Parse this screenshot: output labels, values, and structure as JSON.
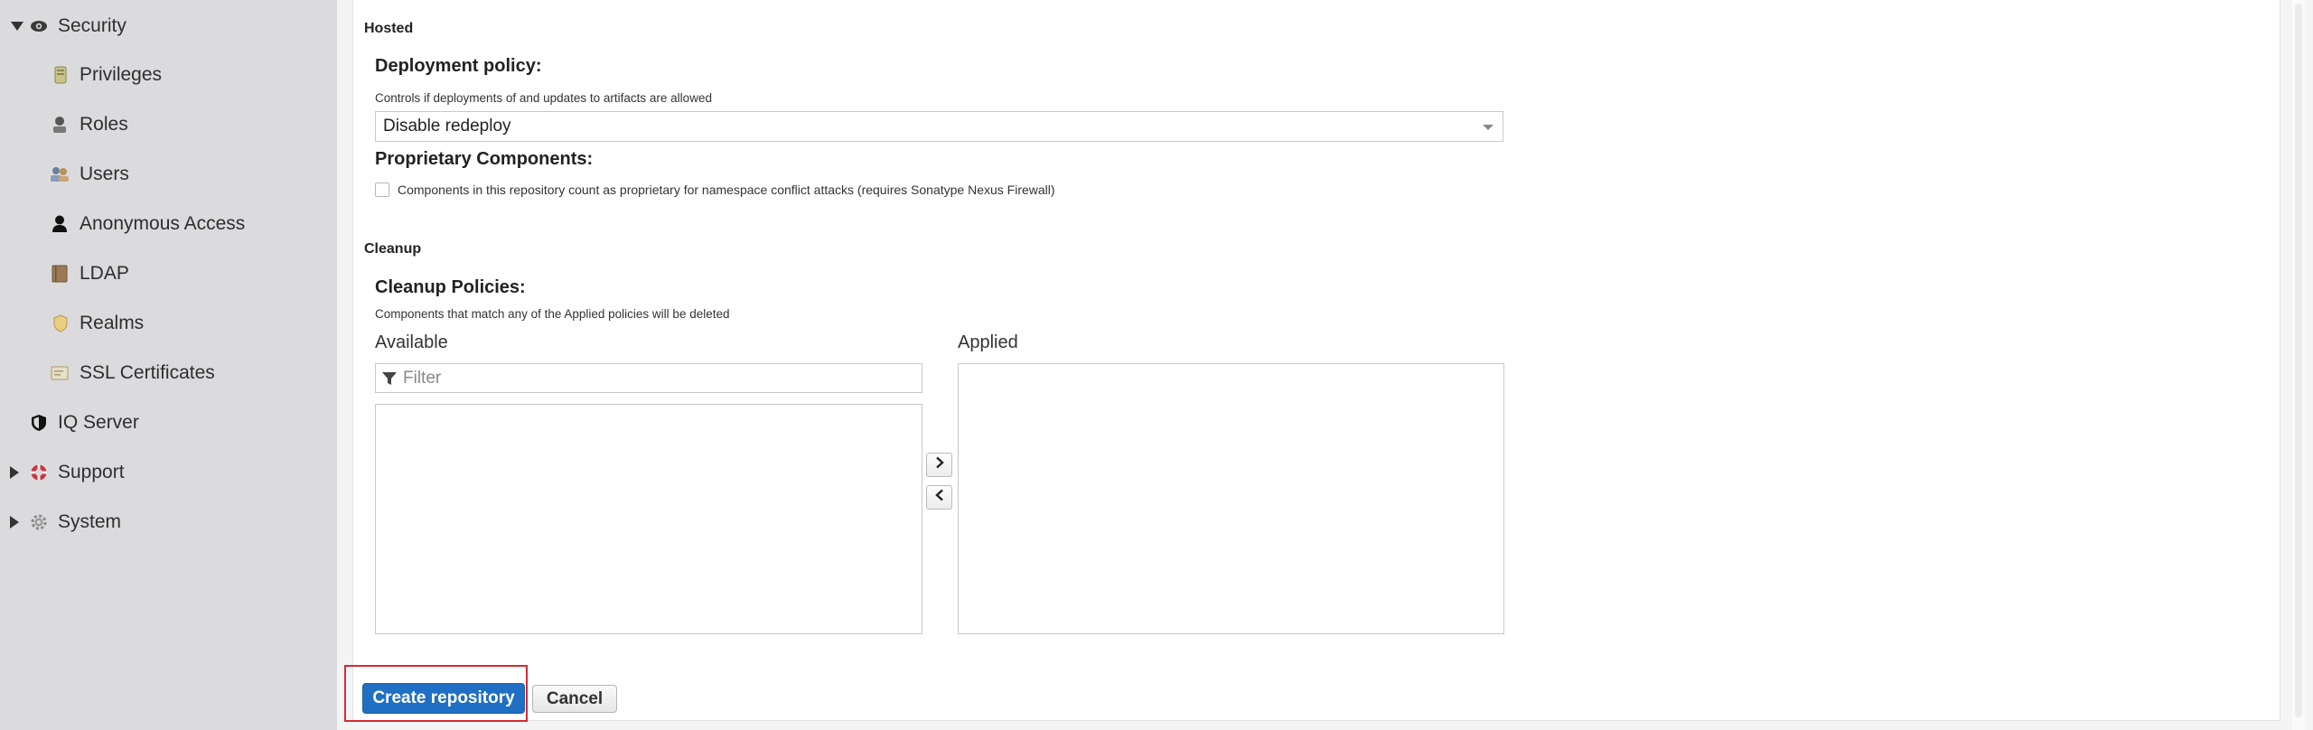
{
  "sidebar": {
    "items": [
      {
        "label": "Security",
        "icon": "eye-icon"
      },
      {
        "label": "Privileges",
        "icon": "privileges-icon"
      },
      {
        "label": "Roles",
        "icon": "roles-icon"
      },
      {
        "label": "Users",
        "icon": "users-icon"
      },
      {
        "label": "Anonymous Access",
        "icon": "anonymous-user-icon"
      },
      {
        "label": "LDAP",
        "icon": "ldap-book-icon"
      },
      {
        "label": "Realms",
        "icon": "realms-shield-icon"
      },
      {
        "label": "SSL Certificates",
        "icon": "ssl-certificate-icon"
      },
      {
        "label": "IQ Server",
        "icon": "iq-server-shield-icon"
      },
      {
        "label": "Support",
        "icon": "support-lifebuoy-icon"
      },
      {
        "label": "System",
        "icon": "system-gear-icon"
      }
    ]
  },
  "hosted": {
    "section_title": "Hosted",
    "deployment_policy_label": "Deployment policy:",
    "deployment_policy_help": "Controls if deployments of and updates to artifacts are allowed",
    "deployment_policy_value": "Disable redeploy",
    "proprietary_label": "Proprietary Components:",
    "proprietary_checkbox_label": "Components in this repository count as proprietary for namespace conflict attacks (requires Sonatype Nexus Firewall)"
  },
  "cleanup": {
    "section_title": "Cleanup",
    "policies_label": "Cleanup Policies:",
    "policies_help": "Components that match any of the Applied policies will be deleted",
    "available_label": "Available",
    "applied_label": "Applied",
    "filter_placeholder": "Filter"
  },
  "actions": {
    "create_label": "Create repository",
    "cancel_label": "Cancel"
  },
  "colors": {
    "primary": "#1f6fc4",
    "highlight": "#d42a35",
    "sidebar_bg": "#dbdbde"
  }
}
